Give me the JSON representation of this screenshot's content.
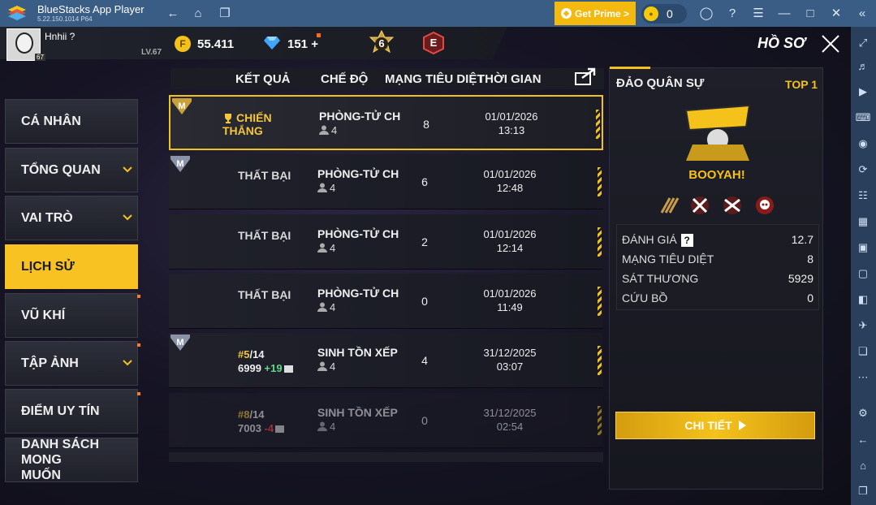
{
  "window": {
    "title": "BlueStacks App Player",
    "version": "5.22.150.1014  P64",
    "prime_label": "Get Prime >",
    "coins": "0"
  },
  "player": {
    "name": "Hnhii ?",
    "level_badge": "67",
    "level": "LV.67",
    "gold": "55.411",
    "diamonds": "151",
    "diamond_add": "+",
    "rank_number": "6",
    "rank_letter": "E"
  },
  "header": {
    "page_title": "HỒ SƠ"
  },
  "nav": {
    "items": [
      {
        "label": "CÁ NHÂN"
      },
      {
        "label": "TỔNG QUAN"
      },
      {
        "label": "VAI TRÒ"
      },
      {
        "label": "LỊCH SỬ"
      },
      {
        "label": "VŨ KHÍ"
      },
      {
        "label": "TẬP ẢNH"
      },
      {
        "label": "ĐIỂM UY TÍN"
      },
      {
        "label": "DANH SÁCH MONG MUỐN"
      }
    ]
  },
  "table": {
    "headers": {
      "result": "KẾT QUẢ",
      "mode": "CHẾ ĐỘ",
      "kills": "MẠNG TIÊU DIỆT",
      "time": "THỜI GIAN"
    },
    "rows": [
      {
        "result": "CHIẾN THẮNG",
        "mode": "PHÒNG-TỬ CHIẾN",
        "squad": "4",
        "kills": "8",
        "date": "01/01/2026",
        "clock": "13:13"
      },
      {
        "result": "THẤT BẠI",
        "mode": "PHÒNG-TỬ CHIẾN",
        "squad": "4",
        "kills": "6",
        "date": "01/01/2026",
        "clock": "12:48"
      },
      {
        "result": "THẤT BẠI",
        "mode": "PHÒNG-TỬ CHIẾN",
        "squad": "4",
        "kills": "2",
        "date": "01/01/2026",
        "clock": "12:14"
      },
      {
        "result": "THẤT BẠI",
        "mode": "PHÒNG-TỬ CHIẾN",
        "squad": "4",
        "kills": "0",
        "date": "01/01/2026",
        "clock": "11:49"
      },
      {
        "place": "#5",
        "of": "/14",
        "points": "6999",
        "delta": "+19",
        "mode": "SINH TỒN XẾP HẠNG",
        "squad": "4",
        "kills": "4",
        "date": "31/12/2025",
        "clock": "03:07"
      },
      {
        "place": "#8",
        "of": "/14",
        "points": "7003",
        "delta": "-4",
        "mode": "SINH TỒN XẾP HẠNG",
        "squad": "4",
        "kills": "0",
        "date": "31/12/2025",
        "clock": "02:54"
      }
    ]
  },
  "detail": {
    "map": "ĐẢO QUÂN SỰ",
    "placement": "TOP 1",
    "outcome": "BOOYAH!",
    "stats": [
      {
        "label": "ĐÁNH GIÁ",
        "value": "12.7"
      },
      {
        "label": "MẠNG TIÊU DIỆT",
        "value": "8"
      },
      {
        "label": "SÁT THƯƠNG",
        "value": "5929"
      },
      {
        "label": "CỨU BỒ",
        "value": "0"
      }
    ],
    "button": "CHI TIẾT"
  },
  "colors": {
    "accent": "#f4c21b",
    "titlebar": "#3a5d86",
    "win": "#f4c63a",
    "delta_up": "#5fd98a",
    "delta_down": "#ff4a4a"
  }
}
